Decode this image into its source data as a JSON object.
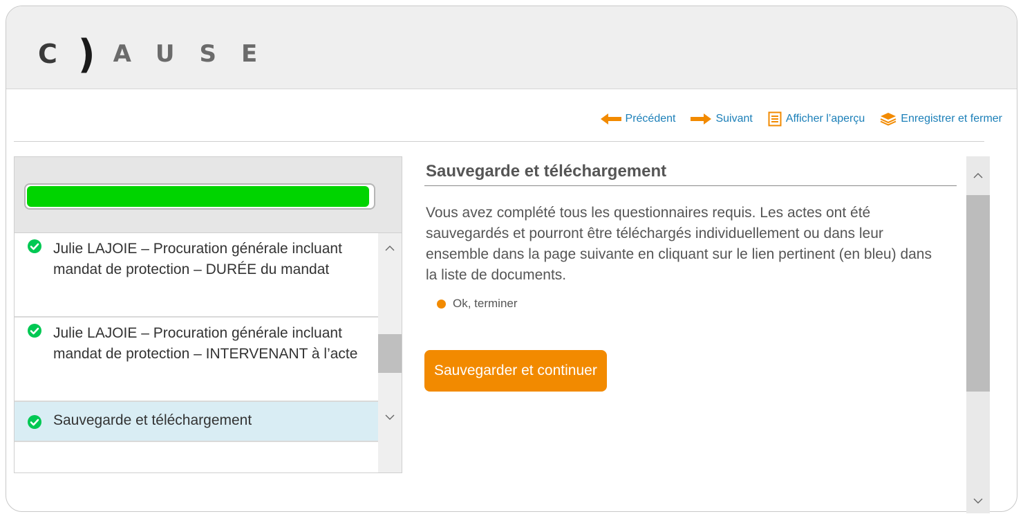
{
  "logo": {
    "c": "C",
    "paren": ")",
    "rest": "AUSE"
  },
  "toolbar": {
    "previous": "Précédent",
    "next": "Suivant",
    "preview": "Afficher l’aperçu",
    "save_close": "Enregistrer et fermer"
  },
  "progress": {
    "percent": 99
  },
  "steps": [
    {
      "label": "Julie LAJOIE – Procuration générale incluant mandat de protection – DURÉE du mandat",
      "done": true
    },
    {
      "label": "Julie LAJOIE – Procuration générale incluant mandat de protection – INTERVENANT à l’acte",
      "done": true
    },
    {
      "label": "Sauvegarde et téléchargement",
      "done": true,
      "active": true
    }
  ],
  "main": {
    "title": "Sauvegarde et téléchargement",
    "text": "Vous avez complété tous les questionnaires requis. Les actes ont été sauvegardés et pourront être téléchargés individuellement ou dans leur ensemble dans la page suivante en cliquant sur le lien pertinent (en bleu) dans la liste de documents.",
    "option": "Ok, terminer",
    "button": "Sauvegarder et continuer"
  },
  "colors": {
    "accent": "#f28a00",
    "link": "#1b7fb8",
    "progress": "#00d400",
    "check": "#00c853",
    "active_row": "#d9edf4"
  },
  "icons": [
    "arrow-left-icon",
    "arrow-right-icon",
    "document-icon",
    "layers-icon",
    "check-circle-icon",
    "chevron-up-icon",
    "chevron-down-icon"
  ]
}
